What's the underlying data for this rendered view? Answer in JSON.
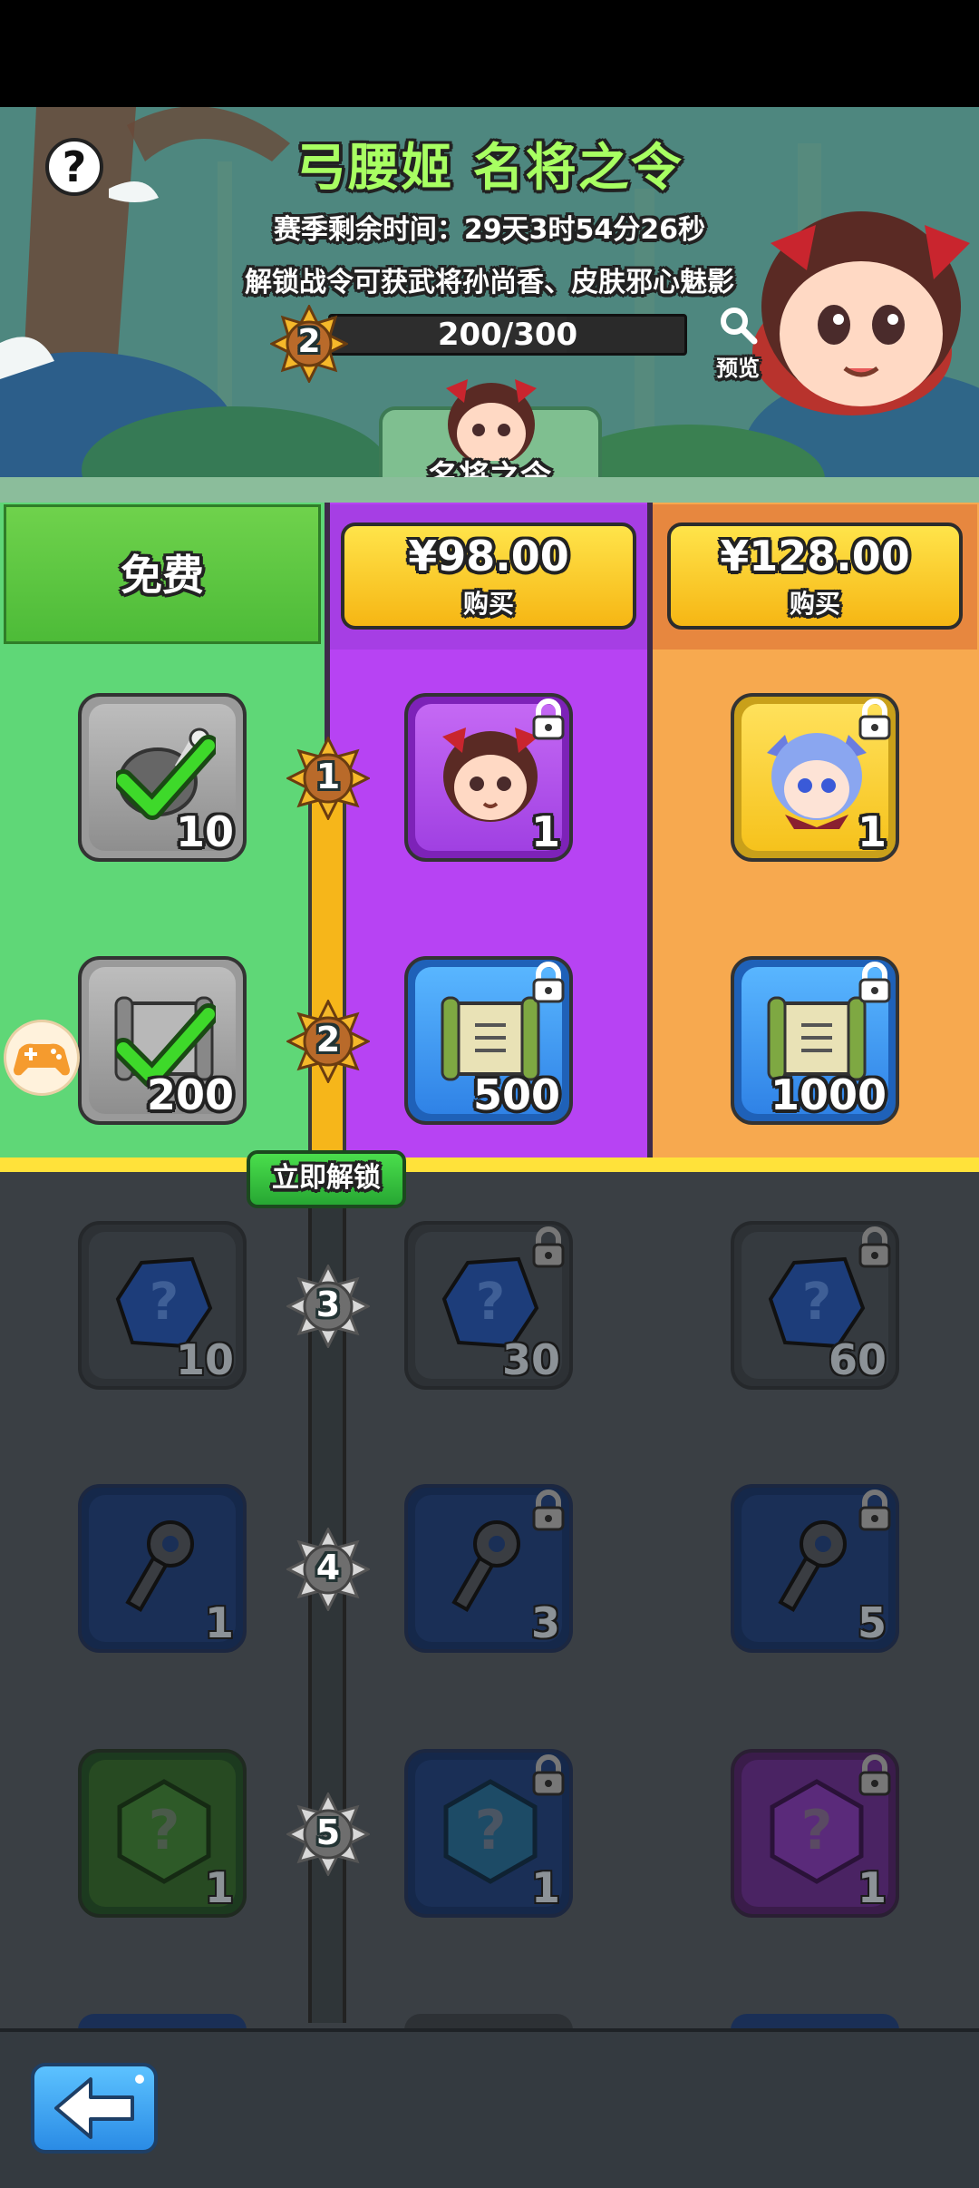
{
  "header": {
    "title": "弓腰姬 名将之令",
    "season_remaining": "赛季剩余时间：29天3时54分26秒",
    "unlock_info": "解锁战令可获武将孙尚香、皮肤邪心魅影",
    "level": "2",
    "progress": "200/300",
    "progress_fraction": 0.6667,
    "preview_label": "预览",
    "help_label": "?",
    "tab_label": "名将之令"
  },
  "tiers": {
    "free": {
      "label": "免费",
      "color": "#5fd777"
    },
    "premium": {
      "price": "¥98.00",
      "buy_label": "购买",
      "color": "#b743f3"
    },
    "deluxe": {
      "price": "¥128.00",
      "buy_label": "购买",
      "color": "#f7a94f"
    }
  },
  "unlock_now_label": "立即解锁",
  "levels": [
    {
      "level": "1",
      "free": {
        "icon": "meat-icon",
        "count": "10",
        "claimed": true
      },
      "premium": {
        "icon": "hero-portrait-icon",
        "count": "1",
        "locked": true
      },
      "deluxe": {
        "icon": "skin-portrait-icon",
        "count": "1",
        "locked": true
      }
    },
    {
      "level": "2",
      "free": {
        "icon": "scroll-icon",
        "count": "200",
        "claimed": true
      },
      "premium": {
        "icon": "scroll-icon",
        "count": "500",
        "locked": true
      },
      "deluxe": {
        "icon": "scroll-icon",
        "count": "1000",
        "locked": true
      }
    },
    {
      "level": "3",
      "free": {
        "icon": "mystery-gem-icon",
        "count": "10"
      },
      "premium": {
        "icon": "mystery-gem-icon",
        "count": "30",
        "locked": true
      },
      "deluxe": {
        "icon": "mystery-gem-icon",
        "count": "60",
        "locked": true
      }
    },
    {
      "level": "4",
      "free": {
        "icon": "key-icon",
        "count": "1"
      },
      "premium": {
        "icon": "key-icon",
        "count": "3",
        "locked": true
      },
      "deluxe": {
        "icon": "key-icon",
        "count": "5",
        "locked": true
      }
    },
    {
      "level": "5",
      "free": {
        "icon": "mystery-hex-icon",
        "count": "1"
      },
      "premium": {
        "icon": "mystery-hex-icon",
        "count": "1",
        "locked": true
      },
      "deluxe": {
        "icon": "mystery-hex-icon",
        "count": "1",
        "locked": true
      }
    }
  ],
  "colors": {
    "accent_green": "#a8ff62",
    "gold": "#f6b61a",
    "bottom_bar": "#343a40"
  },
  "back_icon": "back-arrow-icon",
  "floating_icon": "gamepad-icon"
}
